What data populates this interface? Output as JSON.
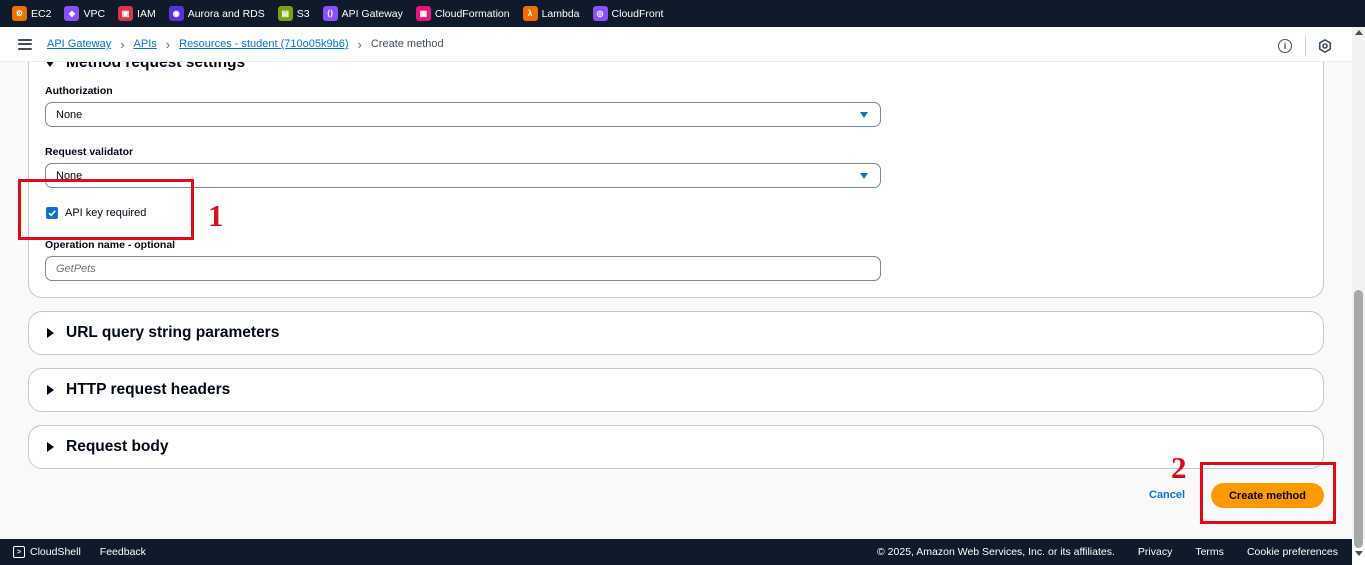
{
  "services": [
    {
      "label": "EC2",
      "icon": "ec2-icon",
      "color": "#ed7100"
    },
    {
      "label": "VPC",
      "icon": "vpc-icon",
      "color": "#8c4fff"
    },
    {
      "label": "IAM",
      "icon": "iam-icon",
      "color": "#dd344c"
    },
    {
      "label": "Aurora and RDS",
      "icon": "rds-icon",
      "color": "#c925d1"
    },
    {
      "label": "S3",
      "icon": "s3-icon",
      "color": "#7aa116"
    },
    {
      "label": "API Gateway",
      "icon": "api-gateway-icon",
      "color": "#8c4fff"
    },
    {
      "label": "CloudFormation",
      "icon": "cloudformation-icon",
      "color": "#e7157b"
    },
    {
      "label": "Lambda",
      "icon": "lambda-icon",
      "color": "#ed7100"
    },
    {
      "label": "CloudFront",
      "icon": "cloudfront-icon",
      "color": "#8c4fff"
    }
  ],
  "breadcrumb": {
    "items": [
      "API Gateway",
      "APIs",
      "Resources - student (710o05k9b6)"
    ],
    "current": "Create method"
  },
  "method_request": {
    "title": "Method request settings",
    "authorization_label": "Authorization",
    "authorization_value": "None",
    "validator_label": "Request validator",
    "validator_value": "None",
    "api_key_label": "API key required",
    "api_key_checked": true,
    "operation_label": "Operation name - optional",
    "operation_placeholder": "GetPets"
  },
  "sections": [
    "URL query string parameters",
    "HTTP request headers",
    "Request body"
  ],
  "actions": {
    "cancel": "Cancel",
    "create": "Create method"
  },
  "annotations": [
    "1",
    "2"
  ],
  "footer": {
    "cloudshell": "CloudShell",
    "feedback": "Feedback",
    "copyright": "© 2025, Amazon Web Services, Inc. or its affiliates.",
    "privacy": "Privacy",
    "terms": "Terms",
    "cookies": "Cookie preferences"
  },
  "colors": {
    "accent": "#0972d3",
    "primary_button": "#ff9900",
    "annotation": "#e00b16",
    "nav_bg": "#0f1b2a"
  }
}
